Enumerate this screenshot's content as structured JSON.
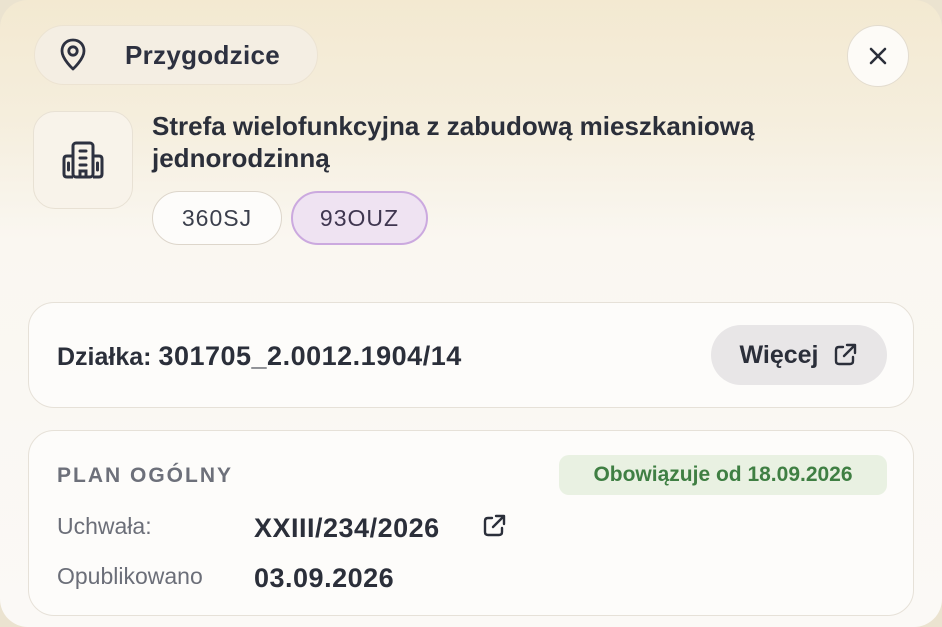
{
  "location": {
    "name": "Przygodzice",
    "icon": "map-pin-icon"
  },
  "close": {
    "icon": "close-icon"
  },
  "zone": {
    "icon": "building-icon",
    "title": "Strefa wielofunkcyjna z zabudową mieszkaniową jednorodzinną",
    "tags": [
      "360SJ",
      "93OUZ"
    ]
  },
  "parcel": {
    "label": "Działka:",
    "number": "301705_2.0012.1904/14",
    "more_label": "Więcej",
    "more_icon": "external-link-icon"
  },
  "plan": {
    "heading": "PLAN OGÓLNY",
    "status": "Obowiązuje od 18.09.2026",
    "resolution_label": "Uchwała:",
    "resolution_value": "XXIII/234/2026",
    "published_label": "Opublikowano",
    "published_value": "03.09.2026"
  },
  "colors": {
    "status_green": "#3f7f43",
    "tag_purple_border": "#cba9df"
  }
}
